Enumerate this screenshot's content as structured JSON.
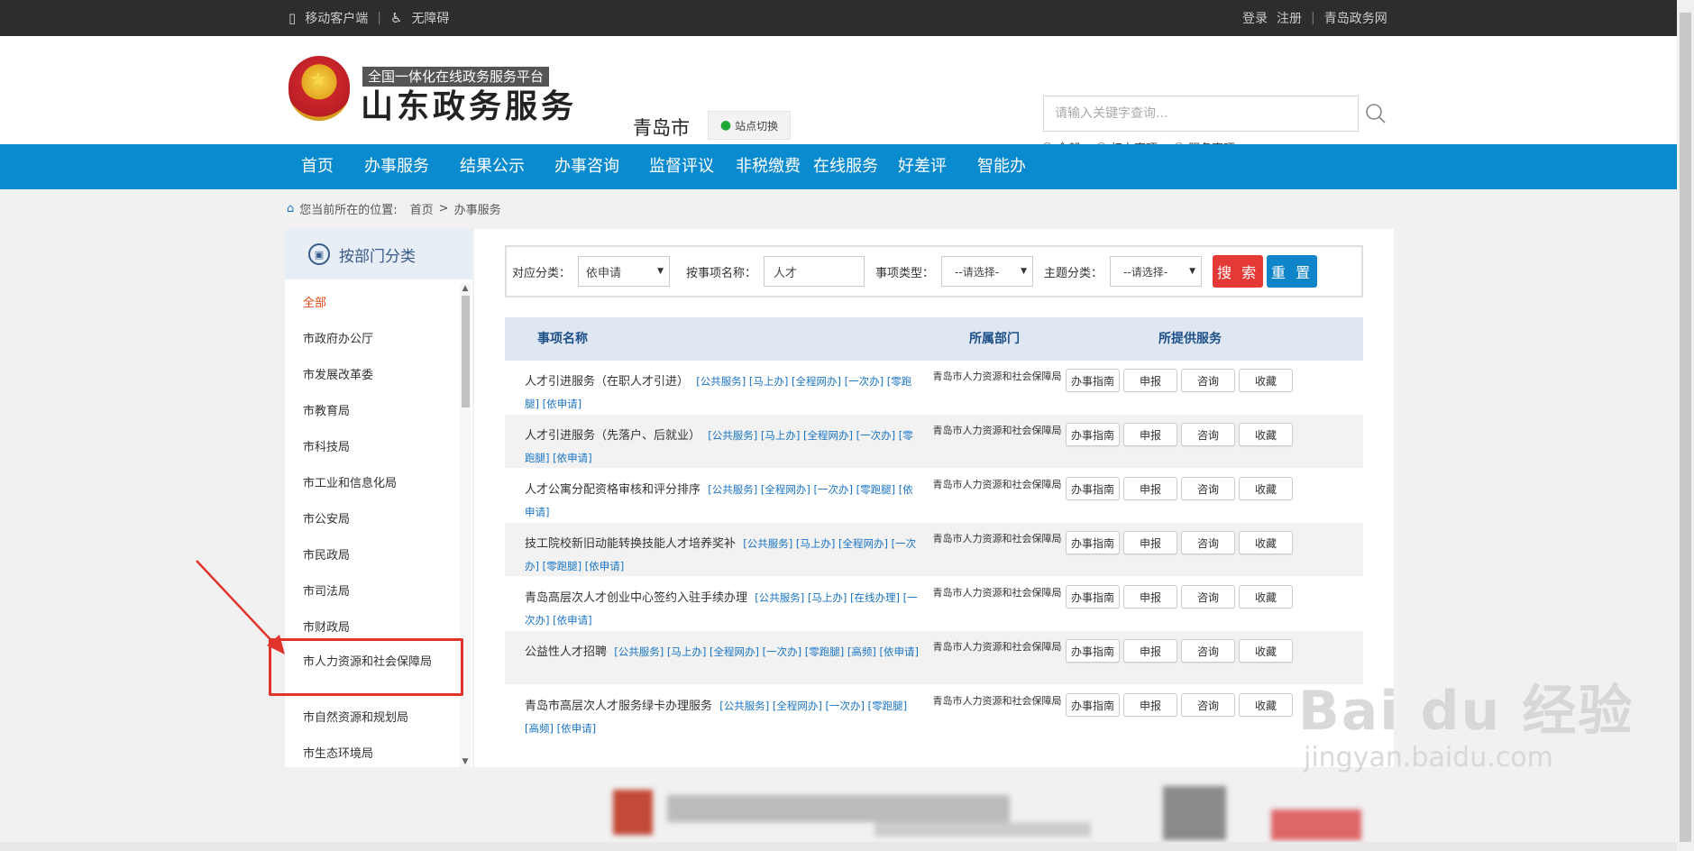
{
  "topbar": {
    "mobile": "移动客户端",
    "accessibility": "无障碍",
    "login": "登录",
    "register": "注册",
    "site": "青岛政务网"
  },
  "header": {
    "slogan": "全国一体化在线政务服务平台",
    "brand": "山东政务服务",
    "city": "青岛市",
    "switch_label": "站点切换",
    "search_placeholder": "请输入关键字查询...",
    "scope_options": [
      "全部",
      "权力事项",
      "服务事项"
    ],
    "scope_selected": "全部"
  },
  "nav": [
    "首页",
    "办事服务",
    "结果公示",
    "办事咨询",
    "监督评议",
    "非税缴费",
    "在线服务",
    "好差评",
    "智能办"
  ],
  "breadcrumb": {
    "prefix": "您当前所在的位置:",
    "home": "首页",
    "sep": ">",
    "current": "办事服务"
  },
  "sidebar": {
    "title": "按部门分类",
    "items": [
      "全部",
      "市政府办公厅",
      "市发展改革委",
      "市教育局",
      "市科技局",
      "市工业和信息化局",
      "市公安局",
      "市民政局",
      "市司法局",
      "市财政局",
      "市人力资源和社会保障局",
      "市自然资源和规划局",
      "市生态环境局"
    ],
    "active": "全部",
    "highlighted": "市人力资源和社会保障局"
  },
  "filter": {
    "category_label": "对应分类：",
    "category_value": "依申请",
    "name_label": "按事项名称：",
    "name_value": "人才",
    "type_label": "事项类型：",
    "type_value": "--请选择-",
    "topic_label": "主题分类：",
    "topic_value": "--请选择-",
    "search_btn": "搜 索",
    "reset_btn": "重 置"
  },
  "table": {
    "headers": [
      "事项名称",
      "所属部门",
      "所提供服务"
    ],
    "rows": [
      {
        "name": "人才引进服务（在职人才引进）",
        "tags": "[公共服务] [马上办] [全程网办] [一次办] [零跑腿] [依申请]",
        "dept": "青岛市人力资源和社会保障局"
      },
      {
        "name": "人才引进服务（先落户、后就业）",
        "tags": "[公共服务] [马上办] [全程网办] [一次办] [零跑腿] [依申请]",
        "dept": "青岛市人力资源和社会保障局"
      },
      {
        "name": "人才公寓分配资格审核和评分排序",
        "tags": "[公共服务] [全程网办] [一次办] [零跑腿] [依申请]",
        "dept": "青岛市人力资源和社会保障局"
      },
      {
        "name": "技工院校新旧动能转换技能人才培养奖补",
        "tags": "[公共服务] [马上办] [全程网办] [一次办] [零跑腿] [依申请]",
        "dept": "青岛市人力资源和社会保障局"
      },
      {
        "name": "青岛高层次人才创业中心签约入驻手续办理",
        "tags": "[公共服务] [马上办] [在线办理] [一次办] [依申请]",
        "dept": "青岛市人力资源和社会保障局"
      },
      {
        "name": "公益性人才招聘",
        "tags": "[公共服务] [马上办] [全程网办] [一次办] [零跑腿] [高频] [依申请]",
        "dept": "青岛市人力资源和社会保障局"
      },
      {
        "name": "青岛市高层次人才服务绿卡办理服务",
        "tags": "[公共服务] [全程网办] [一次办] [零跑腿] [高频] [依申请]",
        "dept": "青岛市人力资源和社会保障局"
      }
    ],
    "ops": [
      "办事指南",
      "申报",
      "咨询",
      "收藏"
    ]
  },
  "watermark": {
    "main": "Bai du 经验",
    "sub": "jingyan.baidu.com"
  },
  "colors": {
    "nav": "#0a8bcf",
    "topbar": "#2d2d2d",
    "search_btn": "#e53935",
    "reset_btn": "#1084c9",
    "highlight": "#e0332c",
    "tag": "#1a74c4"
  }
}
